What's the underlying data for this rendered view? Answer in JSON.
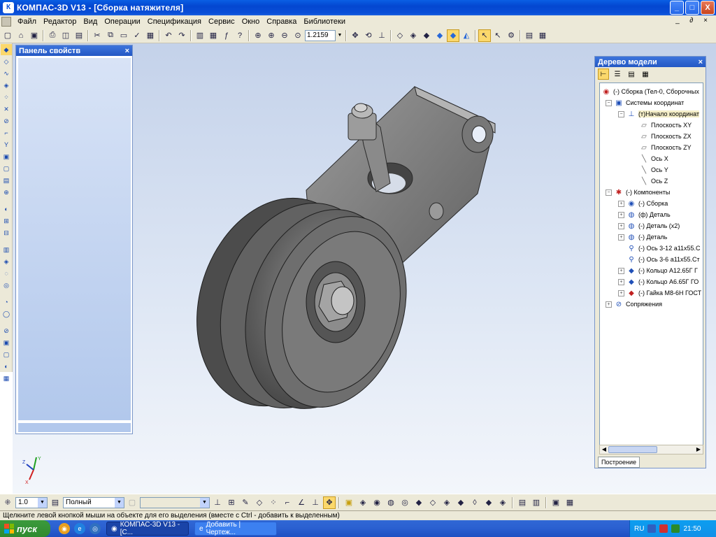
{
  "window": {
    "title": "КОМПАС-3D V13 - [Сборка натяжителя]",
    "app_icon": "К"
  },
  "window_buttons": {
    "minimize": "_",
    "maximize": "□",
    "close": "X"
  },
  "menu": [
    "Файл",
    "Редактор",
    "Вид",
    "Операции",
    "Спецификация",
    "Сервис",
    "Окно",
    "Справка",
    "Библиотеки"
  ],
  "mdi_controls": "_ ∂ ×",
  "toolbar": {
    "zoom_value": "1.2159"
  },
  "property_panel": {
    "title": "Панель свойств",
    "close": "×"
  },
  "model_tree": {
    "title": "Дерево модели",
    "close": "×",
    "tab": "Построение",
    "nodes": [
      {
        "label": "(-) Сборка (Тел-0, Сборочных"
      },
      {
        "label": "Системы координат"
      },
      {
        "label": "(т)Начало координат"
      },
      {
        "label": "Плоскость XY"
      },
      {
        "label": "Плоскость ZX"
      },
      {
        "label": "Плоскость ZY"
      },
      {
        "label": "Ось X"
      },
      {
        "label": "Ось Y"
      },
      {
        "label": "Ось Z"
      },
      {
        "label": "(-) Компоненты"
      },
      {
        "label": "(-) Сборка"
      },
      {
        "label": "(ф) Деталь"
      },
      {
        "label": "(-) Деталь (x2)"
      },
      {
        "label": "(-) Деталь"
      },
      {
        "label": "(-) Ось 3-12 а11х55.С"
      },
      {
        "label": "(-) Ось 3-6 а11х55.Ст"
      },
      {
        "label": "(-) Кольцо А12.65Г Г"
      },
      {
        "label": "(-) Кольцо А6.65Г ГО"
      },
      {
        "label": "(-) Гайка М8-6Н ГОСТ"
      },
      {
        "label": "Сопряжения"
      }
    ]
  },
  "bottom_toolbar": {
    "step_value": "1.0",
    "style_value": "Полный"
  },
  "axes_labels": {
    "x": "X",
    "y": "Y",
    "z": "Z"
  },
  "status": "Щелкните левой кнопкой мыши на объекте для его выделения (вместе с Ctrl - добавить к выделенным)",
  "taskbar": {
    "start": "пуск",
    "tasks": [
      "КОМПАС-3D V13 - [С...",
      "Добавить | Чертеж..."
    ],
    "lang": "RU",
    "clock": "21:50"
  }
}
